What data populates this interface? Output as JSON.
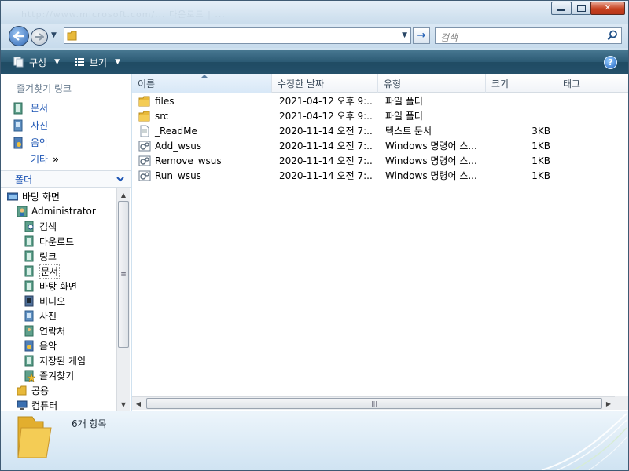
{
  "window": {
    "ghost_title": "http://www.microsoft.com/... 다운로드 | ...",
    "buttons": {
      "minimize": "▭",
      "maximize": "□",
      "close": "✕"
    }
  },
  "address": {
    "path": "",
    "go_symbol": "→",
    "search_placeholder": "검색"
  },
  "toolbar": {
    "organize": "구성",
    "views": "보기",
    "help": "?"
  },
  "favorites": {
    "title": "즐겨찾기 링크",
    "items": [
      {
        "label": "문서"
      },
      {
        "label": "사진"
      },
      {
        "label": "음악"
      }
    ],
    "more": "기타",
    "more_chevron": "»"
  },
  "folders": {
    "title": "폴더",
    "tree": [
      {
        "label": "바탕 화면"
      },
      {
        "label": "Administrator"
      },
      {
        "label": "검색"
      },
      {
        "label": "다운로드"
      },
      {
        "label": "링크"
      },
      {
        "label": "문서"
      },
      {
        "label": "바탕 화면"
      },
      {
        "label": "비디오"
      },
      {
        "label": "사진"
      },
      {
        "label": "연락처"
      },
      {
        "label": "음악"
      },
      {
        "label": "저장된 게임"
      },
      {
        "label": "즐겨찾기"
      },
      {
        "label": "공용"
      },
      {
        "label": "컴퓨터"
      }
    ]
  },
  "columns": {
    "name": "이름",
    "date": "수정한 날짜",
    "type": "유형",
    "size": "크기",
    "tags": "태그"
  },
  "files": [
    {
      "name": "files",
      "date": "2021-04-12 오후 9:...",
      "type": "파일 폴더",
      "size": "",
      "icon": "folder"
    },
    {
      "name": "src",
      "date": "2021-04-12 오후 9:...",
      "type": "파일 폴더",
      "size": "",
      "icon": "folder"
    },
    {
      "name": "_ReadMe",
      "date": "2020-11-14 오전 7:...",
      "type": "텍스트 문서",
      "size": "3KB",
      "icon": "text"
    },
    {
      "name": "Add_wsus",
      "date": "2020-11-14 오전 7:...",
      "type": "Windows 명령어 스...",
      "size": "1KB",
      "icon": "cmd"
    },
    {
      "name": "Remove_wsus",
      "date": "2020-11-14 오전 7:...",
      "type": "Windows 명령어 스...",
      "size": "1KB",
      "icon": "cmd"
    },
    {
      "name": "Run_wsus",
      "date": "2020-11-14 오전 7:...",
      "type": "Windows 명령어 스...",
      "size": "1KB",
      "icon": "cmd"
    }
  ],
  "status": {
    "count": "6개 항목"
  },
  "colors": {
    "toolbar": "#2b5a74",
    "link": "#1c54b3",
    "window_frame": "#cfe1ef"
  }
}
